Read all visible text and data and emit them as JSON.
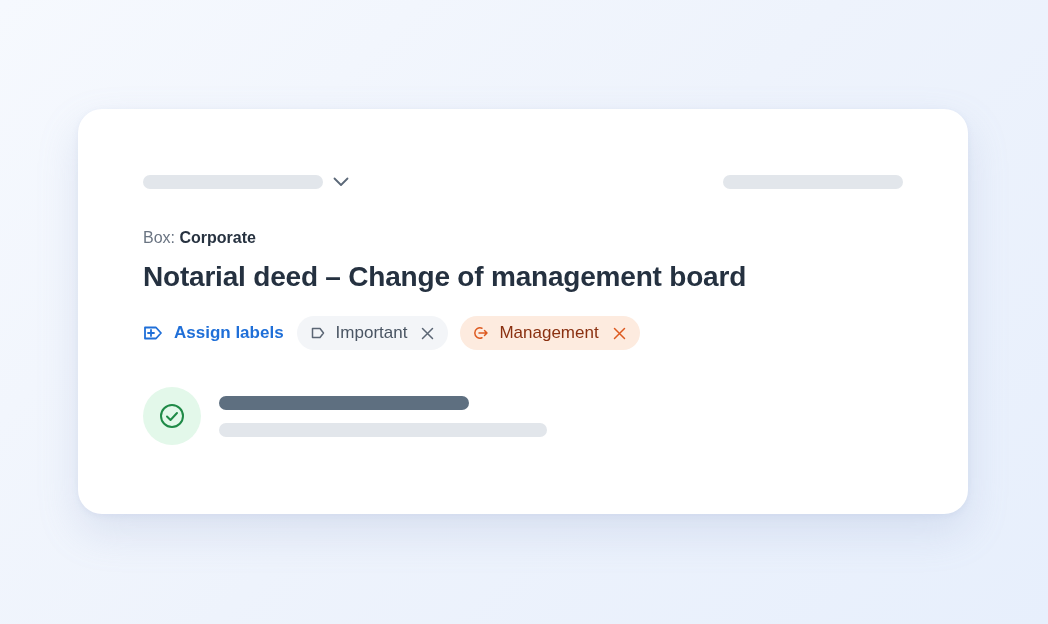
{
  "box": {
    "label": "Box: **Corporate**"
  },
  "title": "Notarial deed – Change of management board",
  "labels": {
    "assign": "Assign labels",
    "items": [
      {
        "text": "Important",
        "kind": "neutral"
      },
      {
        "text": "Management",
        "kind": "accent"
      }
    ]
  }
}
